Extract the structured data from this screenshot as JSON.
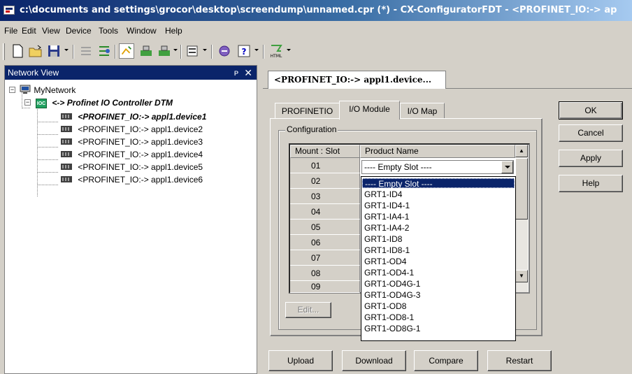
{
  "window": {
    "title": "c:\\documents and settings\\grocor\\desktop\\screendump\\unnamed.cpr (*) - CX-ConfiguratorFDT - <PROFINET_IO:-> ap"
  },
  "menu": [
    "File",
    "Edit",
    "View",
    "Device",
    "Tools",
    "Window",
    "Help"
  ],
  "network_view": {
    "title": "Network View",
    "pin": "ᴘ",
    "close": "✕",
    "root": "MyNetwork",
    "controller": "<-> Profinet IO Controller DTM",
    "controller_badge": "IOC",
    "devices": [
      "<PROFINET_IO:-> appl1.device1",
      "<PROFINET_IO:-> appl1.device2",
      "<PROFINET_IO:-> appl1.device3",
      "<PROFINET_IO:-> appl1.device4",
      "<PROFINET_IO:-> appl1.device5",
      "<PROFINET_IO:-> appl1.device6"
    ]
  },
  "doc_tab": "<PROFINET_IO:-> appl1.device...",
  "tabs": [
    "PROFINETIO",
    "I/O Module",
    "I/O Map"
  ],
  "configuration": {
    "group_label": "Configuration",
    "col_slot": "Mount : Slot",
    "col_product": "Product Name",
    "slots": [
      "01",
      "02",
      "03",
      "04",
      "05",
      "06",
      "07",
      "08",
      "09"
    ],
    "combo_value": "---- Empty Slot ----",
    "edit_button": "Edit..."
  },
  "dropdown_options": [
    "---- Empty Slot ----",
    "GRT1-ID4",
    "GRT1-ID4-1",
    "GRT1-IA4-1",
    "GRT1-IA4-2",
    "GRT1-ID8",
    "GRT1-ID8-1",
    "GRT1-OD4",
    "GRT1-OD4-1",
    "GRT1-OD4G-1",
    "GRT1-OD4G-3",
    "GRT1-OD8",
    "GRT1-OD8-1",
    "GRT1-OD8G-1"
  ],
  "side_buttons": [
    "OK",
    "Cancel",
    "Apply",
    "Help"
  ],
  "bottom_buttons": [
    "Upload",
    "Download",
    "Compare",
    "Restart"
  ],
  "colors": {
    "title_start": "#0a246a",
    "title_end": "#a6caf0",
    "selection": "#0a246a",
    "face": "#d4d0c8"
  }
}
